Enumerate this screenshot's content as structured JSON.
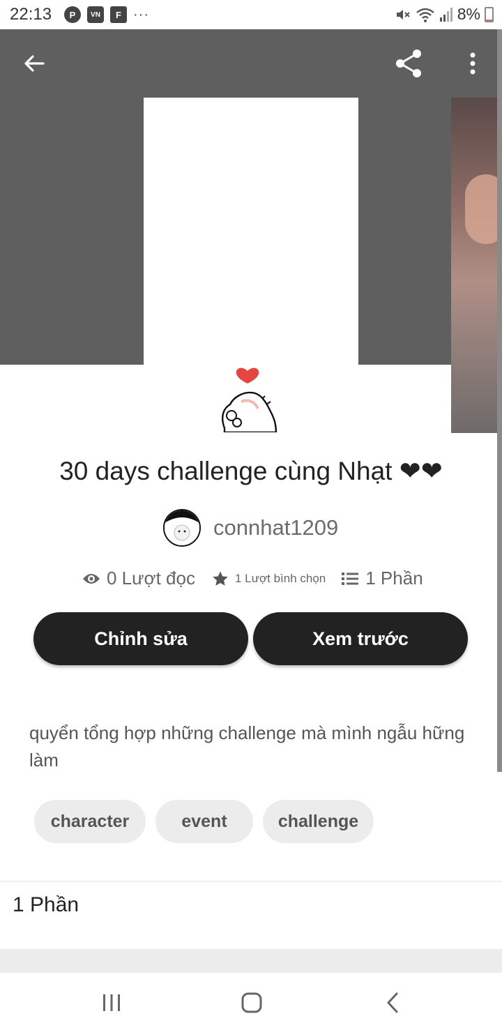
{
  "status_bar": {
    "time": "22:13",
    "app_icons": [
      "pinterest-icon",
      "vnexpress-icon",
      "flipboard-icon"
    ],
    "more": "···",
    "battery": "8%",
    "battery_level": 0.08
  },
  "toolbar": {
    "back_icon": "arrow-left-icon",
    "share_icon": "share-icon",
    "more_icon": "more-vertical-icon"
  },
  "story": {
    "title": "30 days challenge cùng Nhạt ❤❤",
    "author": "connhat1209",
    "stats": {
      "reads": "0 Lượt đọc",
      "votes": "1 Lượt bình chọn",
      "parts": "1 Phần"
    },
    "edit_label": "Chỉnh sửa",
    "preview_label": "Xem trước",
    "description": "quyển tổng hợp những challenge mà mình ngẫu hững làm",
    "tags": [
      "character",
      "event",
      "challenge"
    ]
  },
  "parts_section": {
    "heading": "1 Phần"
  },
  "colors": {
    "header_band": "#5f5f5f",
    "button_bg": "#222222",
    "tag_bg": "#ececec",
    "heart": "#e5463f"
  },
  "nav_bar": {
    "icons": [
      "recent-apps-icon",
      "home-icon",
      "back-icon"
    ]
  }
}
